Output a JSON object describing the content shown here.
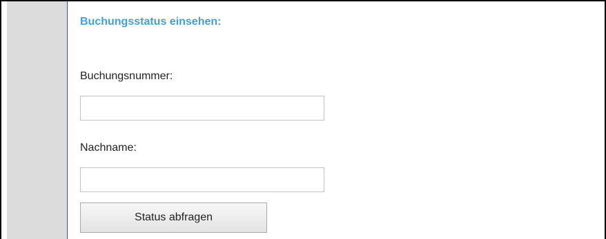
{
  "form": {
    "heading": "Buchungsstatus einsehen:",
    "booking_number": {
      "label": "Buchungsnummer:",
      "value": "",
      "placeholder": ""
    },
    "last_name": {
      "label": "Nachname:",
      "value": "",
      "placeholder": ""
    },
    "submit_label": "Status abfragen"
  },
  "colors": {
    "heading": "#3ca1dc",
    "sidebar": "#dcdcdc",
    "divider": "#3a4f97",
    "text": "#222222"
  }
}
